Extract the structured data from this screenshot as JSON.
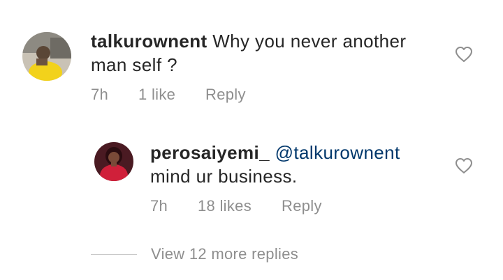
{
  "comments": [
    {
      "username": "talkurownent",
      "text_line1": " Why you never another",
      "text_line2": "man self ?",
      "time": "7h",
      "likes": "1 like",
      "reply": "Reply"
    },
    {
      "username": "perosaiyemi_",
      "mention": "@talkurownent",
      "text_line2": "mind ur business.",
      "time": "7h",
      "likes": "18 likes",
      "reply": "Reply"
    }
  ],
  "view_more": "View 12 more replies",
  "icons": {
    "like": "heart-outline-icon"
  },
  "colors": {
    "text": "#262626",
    "meta": "#8e8e8e",
    "mention": "#00376b"
  }
}
